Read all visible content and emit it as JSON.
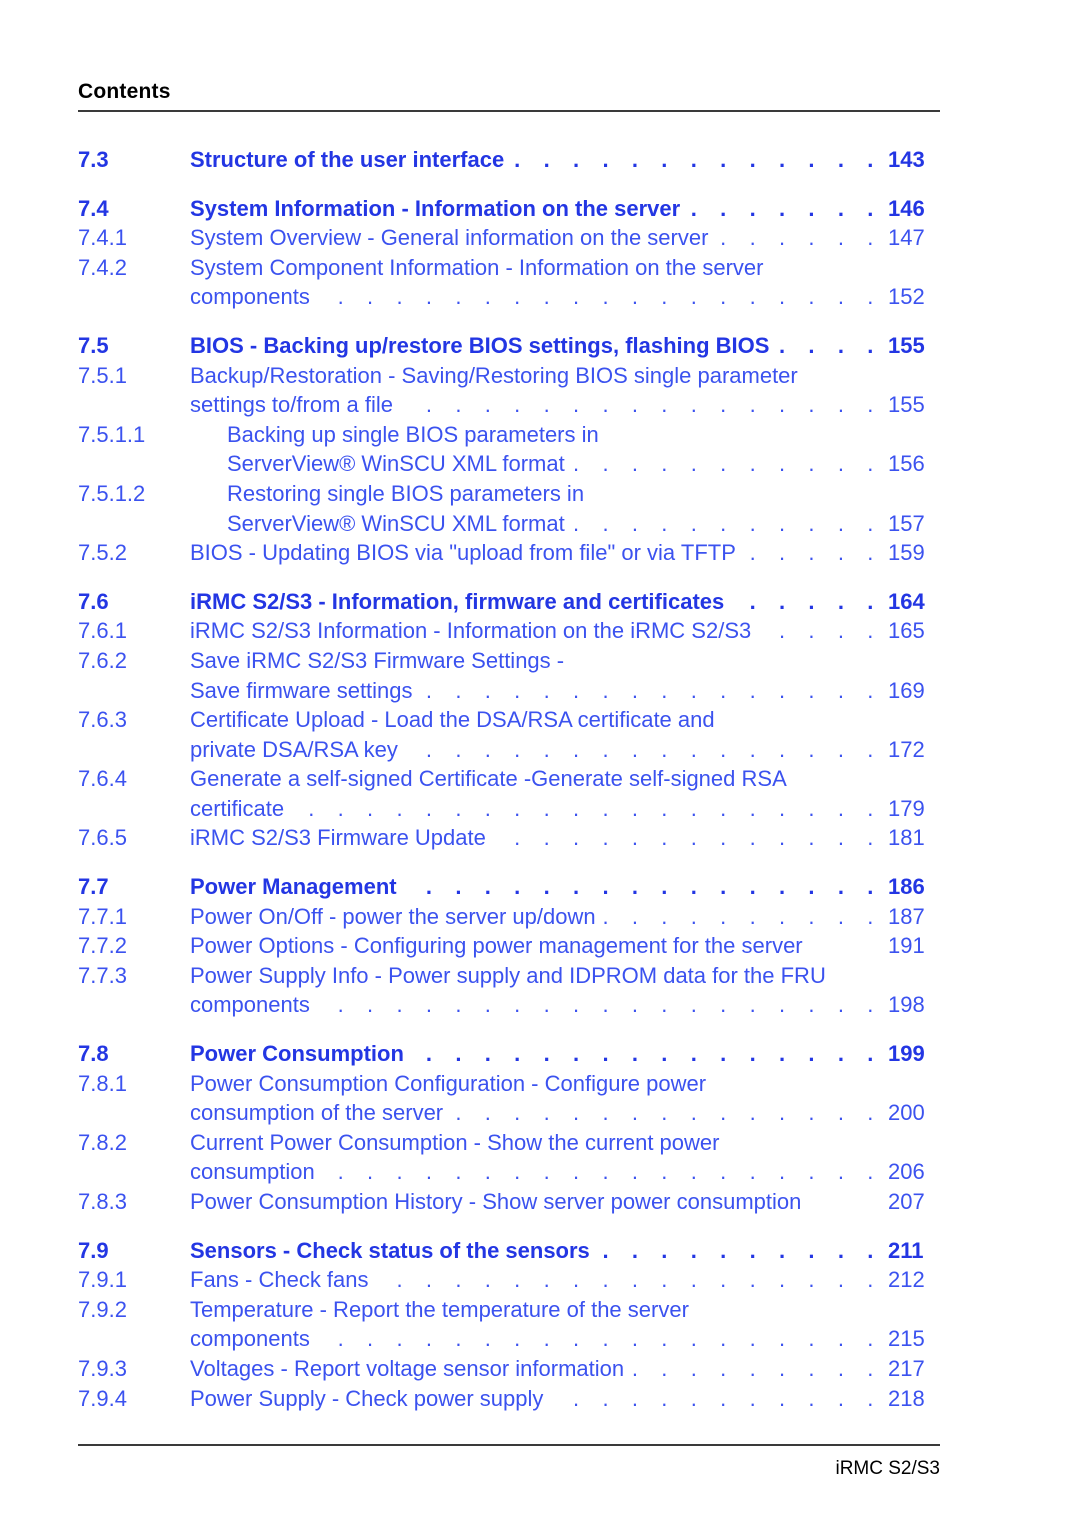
{
  "header": {
    "title": "Contents"
  },
  "footer": {
    "text": "iRMC S2/S3"
  },
  "colors": {
    "heading_blue": "#2336e3",
    "entry_blue": "#3b52ef",
    "rule_gray": "#3a3a3a",
    "header_black": "#000000"
  },
  "toc": {
    "entries": [
      {
        "number": "7.3",
        "level": 1,
        "page": "143",
        "lines": [
          {
            "text": "Structure of the user interface",
            "leader": true,
            "page": "143"
          }
        ]
      },
      {
        "number": "7.4",
        "level": 1,
        "page": "146",
        "lines": [
          {
            "text": "System Information - Information on the server",
            "leader": true,
            "page": "146"
          }
        ]
      },
      {
        "number": "7.4.1",
        "level": 3,
        "page": "147",
        "lines": [
          {
            "text": "System Overview - General information on the server",
            "leader": true,
            "page": "147"
          }
        ]
      },
      {
        "number": "7.4.2",
        "level": 3,
        "page": "152",
        "lines": [
          {
            "text": "System Component Information - Information on the server",
            "leader": false,
            "page": ""
          },
          {
            "text": "components",
            "leader": true,
            "page": "152"
          }
        ]
      },
      {
        "number": "7.5",
        "level": 1,
        "page": "155",
        "lines": [
          {
            "text": "BIOS - Backing up/restore BIOS settings, flashing BIOS",
            "leader": true,
            "page": "155"
          }
        ]
      },
      {
        "number": "7.5.1",
        "level": 3,
        "page": "155",
        "lines": [
          {
            "text": "Backup/Restoration - Saving/Restoring BIOS single parameter",
            "leader": false,
            "page": ""
          },
          {
            "text": "settings to/from a file",
            "leader": true,
            "page": "155"
          }
        ]
      },
      {
        "number": "7.5.1.1",
        "level": 4,
        "page": "156",
        "lines": [
          {
            "text": "Backing up single BIOS parameters in",
            "leader": false,
            "page": ""
          },
          {
            "text": "ServerView® WinSCU XML format",
            "leader": true,
            "page": "156"
          }
        ]
      },
      {
        "number": "7.5.1.2",
        "level": 4,
        "page": "157",
        "lines": [
          {
            "text": "Restoring single BIOS parameters in",
            "leader": false,
            "page": ""
          },
          {
            "text": "ServerView® WinSCU XML format",
            "leader": true,
            "page": "157"
          }
        ]
      },
      {
        "number": "7.5.2",
        "level": 3,
        "page": "159",
        "lines": [
          {
            "text": "BIOS - Updating BIOS via \"upload from file\" or via TFTP",
            "leader": true,
            "page": "159"
          }
        ]
      },
      {
        "number": "7.6",
        "level": 1,
        "page": "164",
        "lines": [
          {
            "text": "iRMC S2/S3 - Information, firmware and certificates",
            "leader": true,
            "page": "164"
          }
        ]
      },
      {
        "number": "7.6.1",
        "level": 3,
        "page": "165",
        "lines": [
          {
            "text": "iRMC S2/S3 Information - Information on the iRMC S2/S3",
            "leader": true,
            "page": "165"
          }
        ]
      },
      {
        "number": "7.6.2",
        "level": 3,
        "page": "169",
        "lines": [
          {
            "text": "Save iRMC S2/S3 Firmware Settings -",
            "leader": false,
            "page": ""
          },
          {
            "text": "Save firmware settings",
            "leader": true,
            "page": "169"
          }
        ]
      },
      {
        "number": "7.6.3",
        "level": 3,
        "page": "172",
        "lines": [
          {
            "text": "Certificate Upload - Load the DSA/RSA certificate and",
            "leader": false,
            "page": ""
          },
          {
            "text": "private DSA/RSA key",
            "leader": true,
            "page": "172"
          }
        ]
      },
      {
        "number": "7.6.4",
        "level": 3,
        "page": "179",
        "lines": [
          {
            "text": "Generate a self-signed Certificate -Generate self-signed RSA",
            "leader": false,
            "page": ""
          },
          {
            "text": "certificate",
            "leader": true,
            "page": "179"
          }
        ]
      },
      {
        "number": "7.6.5",
        "level": 3,
        "page": "181",
        "lines": [
          {
            "text": "iRMC S2/S3 Firmware Update",
            "leader": true,
            "page": "181"
          }
        ]
      },
      {
        "number": "7.7",
        "level": 1,
        "page": "186",
        "lines": [
          {
            "text": "Power Management",
            "leader": true,
            "page": "186"
          }
        ]
      },
      {
        "number": "7.7.1",
        "level": 3,
        "page": "187",
        "lines": [
          {
            "text": "Power On/Off - power the server up/down",
            "leader": true,
            "page": "187"
          }
        ]
      },
      {
        "number": "7.7.2",
        "level": 3,
        "page": "191",
        "lines": [
          {
            "text": "Power Options - Configuring power management for the server",
            "leader": false,
            "page": "191"
          }
        ]
      },
      {
        "number": "7.7.3",
        "level": 3,
        "page": "198",
        "lines": [
          {
            "text": "Power Supply Info - Power supply and IDPROM data for the FRU",
            "leader": false,
            "page": ""
          },
          {
            "text": "components",
            "leader": true,
            "page": "198"
          }
        ]
      },
      {
        "number": "7.8",
        "level": 1,
        "page": "199",
        "lines": [
          {
            "text": "Power Consumption",
            "leader": true,
            "page": "199"
          }
        ]
      },
      {
        "number": "7.8.1",
        "level": 3,
        "page": "200",
        "lines": [
          {
            "text": "Power Consumption Configuration - Configure power",
            "leader": false,
            "page": ""
          },
          {
            "text": "consumption of the server",
            "leader": true,
            "page": "200"
          }
        ]
      },
      {
        "number": "7.8.2",
        "level": 3,
        "page": "206",
        "lines": [
          {
            "text": "Current Power Consumption - Show the current power",
            "leader": false,
            "page": ""
          },
          {
            "text": "consumption",
            "leader": true,
            "page": "206"
          }
        ]
      },
      {
        "number": "7.8.3",
        "level": 3,
        "page": "207",
        "lines": [
          {
            "text": "Power Consumption History - Show server power consumption",
            "leader": false,
            "page": "207"
          }
        ]
      },
      {
        "number": "7.9",
        "level": 1,
        "page": "211",
        "lines": [
          {
            "text": "Sensors - Check status of the sensors",
            "leader": true,
            "page": "211"
          }
        ]
      },
      {
        "number": "7.9.1",
        "level": 3,
        "page": "212",
        "lines": [
          {
            "text": "Fans - Check fans",
            "leader": true,
            "page": "212"
          }
        ]
      },
      {
        "number": "7.9.2",
        "level": 3,
        "page": "215",
        "lines": [
          {
            "text": "Temperature - Report the temperature of the server",
            "leader": false,
            "page": ""
          },
          {
            "text": "components",
            "leader": true,
            "page": "215"
          }
        ]
      },
      {
        "number": "7.9.3",
        "level": 3,
        "page": "217",
        "lines": [
          {
            "text": "Voltages - Report voltage sensor information",
            "leader": true,
            "page": "217"
          }
        ]
      },
      {
        "number": "7.9.4",
        "level": 3,
        "page": "218",
        "lines": [
          {
            "text": "Power Supply - Check power supply",
            "leader": true,
            "page": "218"
          }
        ]
      }
    ]
  }
}
